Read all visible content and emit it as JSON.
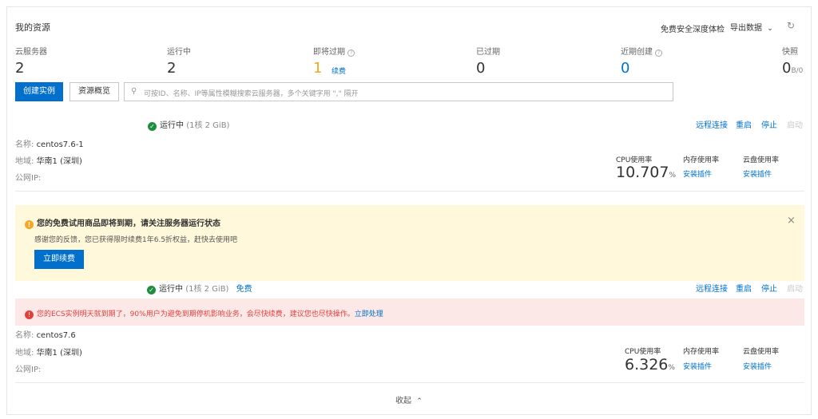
{
  "header": {
    "title": "我的资源",
    "deep_check": "免费安全深度体检",
    "export_label": "导出数据"
  },
  "stats": [
    {
      "label": "云服务器",
      "value": "2"
    },
    {
      "label": "运行中",
      "value": "2"
    },
    {
      "label": "即将过期",
      "value": "1",
      "action": "续费"
    },
    {
      "label": "已过期",
      "value": "0"
    },
    {
      "label": "近期创建",
      "value": "0"
    },
    {
      "label": "快照",
      "value": "0",
      "unit": "B/0"
    }
  ],
  "toolbar": {
    "create_label": "创建实例",
    "overview_label": "资源概览",
    "search_placeholder": "可按ID、名称、IP等属性模糊搜索云服务器，多个关键字用 \",\" 隔开"
  },
  "instances": [
    {
      "status": "运行中",
      "spec": "(1核 2 GiB)",
      "free_tag": "",
      "actions": {
        "remote": "远程连接",
        "restart": "重启",
        "stop": "停止",
        "start": "启动"
      },
      "name_label": "名称:",
      "name": "centos7.6-1",
      "region_label": "地域:",
      "region": "华南1 (深圳)",
      "ip_label": "公网IP:",
      "cpu_label": "CPU使用率",
      "cpu_value": "10.707",
      "cpu_unit": "%",
      "mem_label": "内存使用率",
      "mem_action": "安装插件",
      "disk_label": "云盘使用率",
      "disk_action": "安装插件"
    },
    {
      "status": "运行中",
      "spec": "(1核 2 GiB)",
      "free_tag": "免费",
      "actions": {
        "remote": "远程连接",
        "restart": "重启",
        "stop": "停止",
        "start": "启动"
      },
      "name_label": "名称:",
      "name": "centos7.6",
      "region_label": "地域:",
      "region": "华南1 (深圳)",
      "ip_label": "公网IP:",
      "cpu_label": "CPU使用率",
      "cpu_value": "6.326",
      "cpu_unit": "%",
      "mem_label": "内存使用率",
      "mem_action": "安装插件",
      "disk_label": "云盘使用率",
      "disk_action": "安装插件"
    }
  ],
  "trial_notice": {
    "title": "您的免费试用商品即将到期，请关注服务器运行状态",
    "body": "感谢您的反馈，您已获得限时续费1年6.5折权益，赶快去使用吧",
    "button": "立即续费"
  },
  "expire_alert": {
    "text": "您的ECS实例明天就到期了，90%用户为避免到期停机影响业务，会尽快续费，建议您也尽快操作。",
    "action": "立即处理"
  },
  "footer": {
    "collapse_label": "收起"
  },
  "colors": {
    "primary": "#0070cc",
    "ok": "#1e8e3e",
    "warn_bg": "#fff8db",
    "err_bg": "#fde8e8",
    "expiring_value": "#f5a623"
  }
}
